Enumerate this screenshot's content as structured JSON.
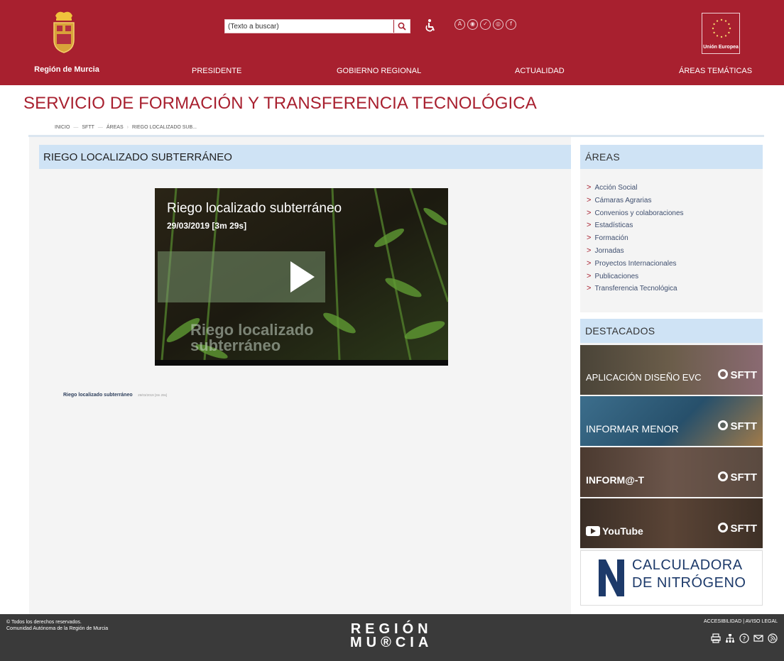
{
  "header": {
    "region_name": "Región de Murcia",
    "search_placeholder": "(Texto a buscar)",
    "eu_label": "Unión Europea",
    "social_icons": [
      "a-icon",
      "rss-icon",
      "twitter-icon",
      "instagram-icon",
      "facebook-icon"
    ],
    "nav": [
      "PRESIDENTE",
      "GOBIERNO REGIONAL",
      "ACTUALIDAD",
      "ÁREAS TEMÁTICAS"
    ]
  },
  "page": {
    "title": "SERVICIO DE FORMACIÓN Y TRANSFERENCIA TECNOLÓGICA",
    "breadcrumb": [
      "INICIO",
      "SFTT",
      "ÁREAS",
      "RIEGO LOCALIZADO SUB..."
    ]
  },
  "main": {
    "heading": "RIEGO LOCALIZADO SUBTERRÁNEO",
    "video": {
      "title": "Riego localizado subterráneo",
      "date": "29/03/2019 [3m 29s]",
      "watermark": "Riego localizado\nsubterráneo"
    },
    "caption": {
      "title": "Riego localizado subterráneo",
      "details": "29/03/2019 [3m 29s]"
    }
  },
  "sidebar": {
    "areas_heading": "ÁREAS",
    "areas": [
      "Acción Social",
      "Cámaras Agrarias",
      "Convenios y colaboraciones",
      "Estadísticas",
      "Formación",
      "Jornadas",
      "Proyectos Internacionales",
      "Publicaciones",
      "Transferencia Tecnológica"
    ],
    "dest_heading": "DESTACADOS",
    "banners": [
      {
        "text": "APLICACIÓN DISEÑO EVC",
        "brand": "SFTT"
      },
      {
        "text": "INFORMAR MENOR",
        "brand": "SFTT"
      },
      {
        "text": "INFORM@-T",
        "brand": "SFTT"
      },
      {
        "text": "YouTube",
        "brand": "SFTT"
      }
    ],
    "calc_line1": "CALCULADORA",
    "calc_line2": "DE NITRÓGENO"
  },
  "footer": {
    "copyright_line1": "© Todos los derechos reservados.",
    "copyright_line2": "Comunidad Autónoma de la Región de Murcia",
    "logo_line1": "REGIÓN",
    "logo_line2": "MU®CIA",
    "accessibility": "ACCESIBILIDAD",
    "legal": "AVISO LEGAL",
    "icons": [
      "print-icon",
      "sitemap-icon",
      "help-icon",
      "email-icon",
      "rss-icon"
    ]
  },
  "colors": {
    "brand_red": "#a8202f",
    "panel_blue": "#cfe3f5",
    "footer_gray": "#3a3a3a"
  }
}
